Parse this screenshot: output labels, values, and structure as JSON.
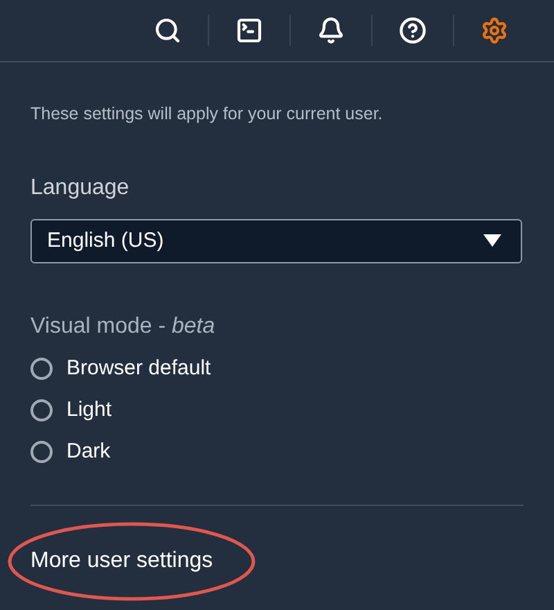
{
  "toolbar": [
    {
      "kind": "search",
      "selected": false
    },
    {
      "kind": "terminal",
      "selected": false
    },
    {
      "kind": "notifications",
      "selected": false
    },
    {
      "kind": "help",
      "selected": false
    },
    {
      "kind": "settings",
      "selected": true
    }
  ],
  "intro": "These settings will apply for your current user.",
  "language": {
    "label": "Language",
    "value": "English (US)"
  },
  "visual_mode": {
    "label": "Visual mode - *beta*",
    "options": [
      {
        "label": "Browser default",
        "selected": false
      },
      {
        "label": "Light",
        "selected": false
      },
      {
        "label": "Dark",
        "selected": false
      }
    ]
  },
  "more_link": {
    "label": "More user settings",
    "circled": true
  }
}
